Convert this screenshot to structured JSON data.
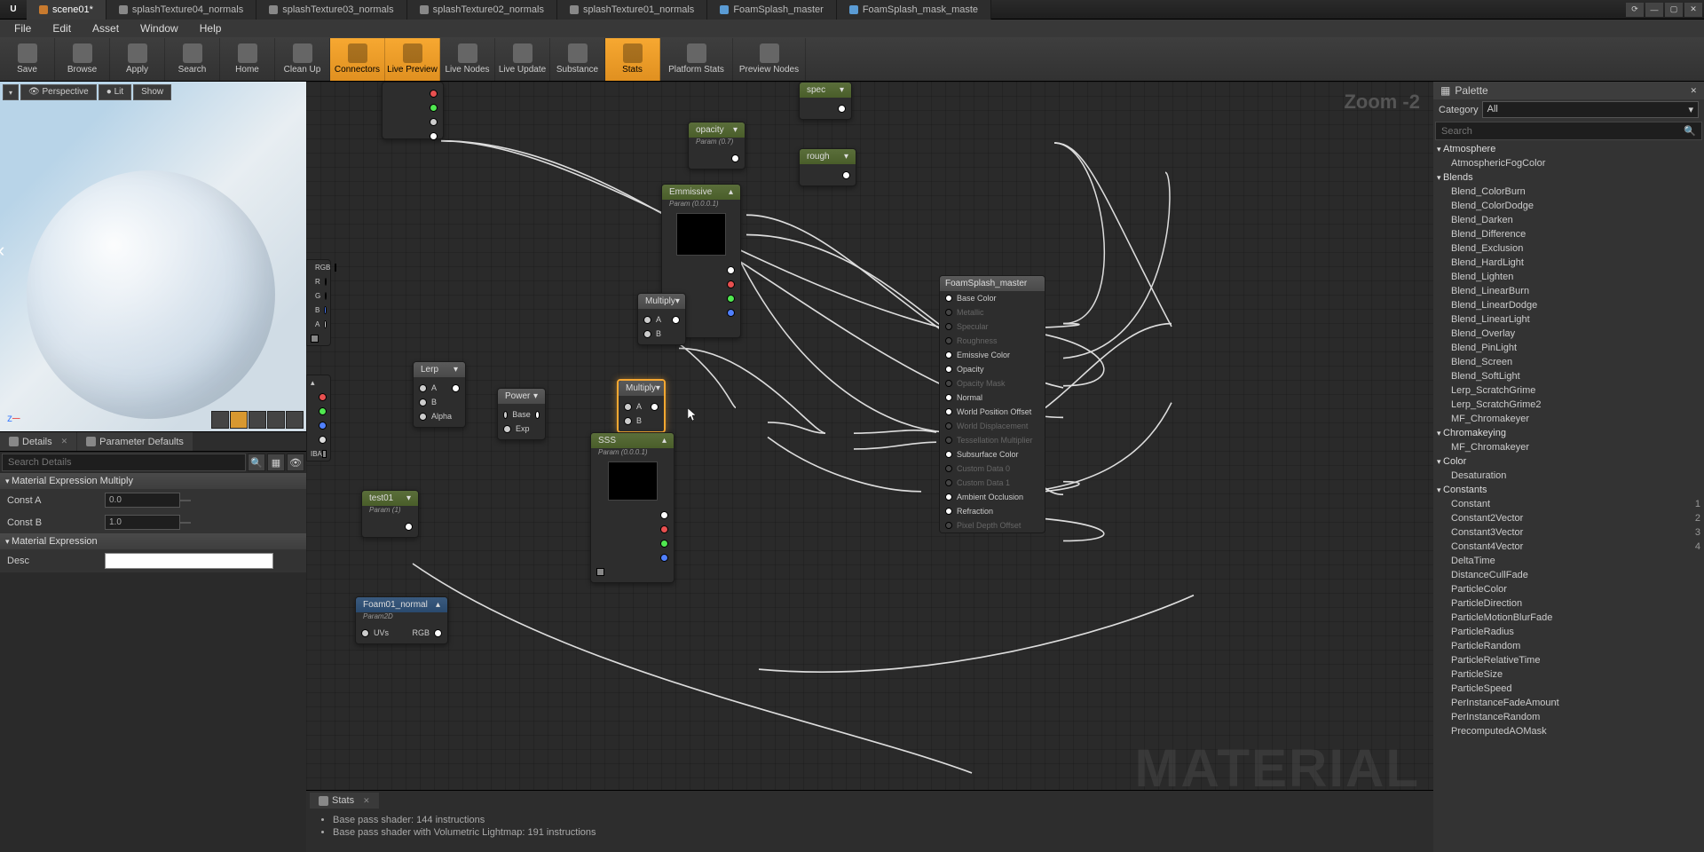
{
  "tabs": [
    "scene01*",
    "splashTexture04_normals",
    "splashTexture03_normals",
    "splashTexture02_normals",
    "splashTexture01_normals",
    "FoamSplash_master",
    "FoamSplash_mask_maste"
  ],
  "menu": [
    "File",
    "Edit",
    "Asset",
    "Window",
    "Help"
  ],
  "toolbar": [
    {
      "label": "Save"
    },
    {
      "label": "Browse"
    },
    {
      "label": "Apply"
    },
    {
      "label": "Search"
    },
    {
      "label": "Home"
    },
    {
      "label": "Clean Up"
    },
    {
      "label": "Connectors",
      "active": true
    },
    {
      "label": "Live Preview",
      "active": true
    },
    {
      "label": "Live Nodes"
    },
    {
      "label": "Live Update"
    },
    {
      "label": "Substance"
    },
    {
      "label": "Stats",
      "active": true
    },
    {
      "label": "Platform Stats",
      "wide": true
    },
    {
      "label": "Preview Nodes",
      "wide": true
    }
  ],
  "viewport": {
    "perspective": "Perspective",
    "lit": "Lit",
    "show": "Show"
  },
  "panelTabs": {
    "details": "Details",
    "paramDefaults": "Parameter Defaults"
  },
  "searchPlaceholder": "Search Details",
  "detailSections": {
    "multiply": "Material Expression Multiply",
    "constA": "Const A",
    "constAVal": "0.0",
    "constB": "Const B",
    "constBVal": "1.0",
    "expr": "Material Expression",
    "desc": "Desc"
  },
  "zoom": "Zoom -2",
  "watermark": "MATERIAL",
  "nodes": {
    "opacity": {
      "title": "opacity",
      "sub": "Param (0.7)"
    },
    "spec": {
      "title": "spec"
    },
    "rough": {
      "title": "rough"
    },
    "emissive": {
      "title": "Emmissive",
      "sub": "Param (0.0.0.1)"
    },
    "multiply1": {
      "title": "Multiply"
    },
    "multiply2": {
      "title": "Multiply"
    },
    "lerp": {
      "title": "Lerp"
    },
    "power": {
      "title": "Power"
    },
    "sss": {
      "title": "SSS",
      "sub": "Param (0.0.0.1)"
    },
    "test01": {
      "title": "test01",
      "sub": "Param (1)"
    },
    "foam": {
      "title": "Foam01_normal",
      "sub": "Param2D"
    }
  },
  "pins": {
    "a": "A",
    "b": "B",
    "alpha": "Alpha",
    "base": "Base",
    "exp": "Exp",
    "uvs": "UVs",
    "rgb": "RGB",
    "rgbh": "RGB",
    "r": "R",
    "g": "G",
    "bb": "B",
    "aa": "A",
    "rgba": "RGBA",
    "iba": "IBA"
  },
  "master": {
    "title": "FoamSplash_master",
    "pins": [
      {
        "l": "Base Color",
        "on": true
      },
      {
        "l": "Metallic"
      },
      {
        "l": "Specular"
      },
      {
        "l": "Roughness"
      },
      {
        "l": "Emissive Color",
        "on": true
      },
      {
        "l": "Opacity",
        "on": true
      },
      {
        "l": "Opacity Mask"
      },
      {
        "l": "Normal",
        "on": true
      },
      {
        "l": "World Position Offset",
        "on": true
      },
      {
        "l": "World Displacement"
      },
      {
        "l": "Tessellation Multiplier"
      },
      {
        "l": "Subsurface Color",
        "on": true
      },
      {
        "l": "Custom Data 0"
      },
      {
        "l": "Custom Data 1"
      },
      {
        "l": "Ambient Occlusion",
        "on": true
      },
      {
        "l": "Refraction",
        "on": true
      },
      {
        "l": "Pixel Depth Offset"
      }
    ]
  },
  "palette": {
    "title": "Palette",
    "category": "Category",
    "all": "All",
    "search": "Search",
    "cats": [
      {
        "name": "Atmosphere",
        "items": [
          "AtmosphericFogColor"
        ]
      },
      {
        "name": "Blends",
        "items": [
          "Blend_ColorBurn",
          "Blend_ColorDodge",
          "Blend_Darken",
          "Blend_Difference",
          "Blend_Exclusion",
          "Blend_HardLight",
          "Blend_Lighten",
          "Blend_LinearBurn",
          "Blend_LinearDodge",
          "Blend_LinearLight",
          "Blend_Overlay",
          "Blend_PinLight",
          "Blend_Screen",
          "Blend_SoftLight",
          "Lerp_ScratchGrime",
          "Lerp_ScratchGrime2",
          "MF_Chromakeyer"
        ]
      },
      {
        "name": "Chromakeying",
        "items": [
          "MF_Chromakeyer"
        ],
        "skip": true
      },
      {
        "name": "Color",
        "items": [
          "Desaturation"
        ]
      },
      {
        "name": "Constants",
        "items": [
          {
            "n": "Constant",
            "k": "1"
          },
          {
            "n": "Constant2Vector",
            "k": "2"
          },
          {
            "n": "Constant3Vector",
            "k": "3"
          },
          {
            "n": "Constant4Vector",
            "k": "4"
          },
          "DeltaTime",
          "DistanceCullFade",
          "ParticleColor",
          "ParticleDirection",
          "ParticleMotionBlurFade",
          "ParticleRadius",
          "ParticleRandom",
          "ParticleRelativeTime",
          "ParticleSize",
          "ParticleSpeed",
          "PerInstanceFadeAmount",
          "PerInstanceRandom",
          "PrecomputedAOMask"
        ]
      }
    ]
  },
  "stats": {
    "title": "Stats",
    "line1": "Base pass shader: 144 instructions",
    "line2": "Base pass shader with Volumetric Lightmap: 191 instructions"
  }
}
